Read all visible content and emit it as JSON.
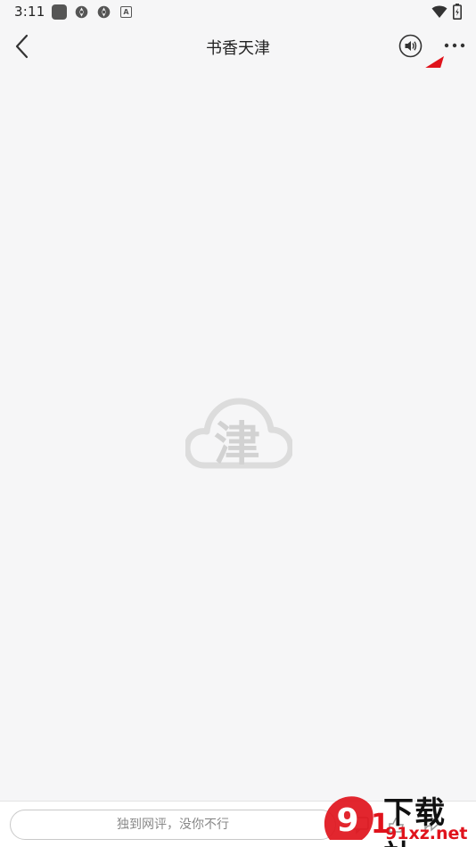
{
  "status_bar": {
    "time": "3:11",
    "notification_icons": [
      "app-square-icon",
      "settings-gear-icon",
      "settings-gear-icon",
      "a-box-icon"
    ],
    "right_icons": [
      "wifi-icon",
      "battery-icon"
    ]
  },
  "nav": {
    "title": "书香天津",
    "back_icon": "chevron-left-icon",
    "audio_icon": "speaker-icon",
    "more_icon": "more-dots-icon"
  },
  "content": {
    "placeholder_logo": "cloud-jin-logo",
    "placeholder_logo_text": "津"
  },
  "bottom": {
    "comment_placeholder": "独到网评，没你不行"
  },
  "watermark": {
    "brand_top": "下载站",
    "brand_bottom": "91xz.net"
  },
  "colors": {
    "background": "#f6f6f7",
    "annotation_red": "#e0131c",
    "text": "#222222"
  }
}
